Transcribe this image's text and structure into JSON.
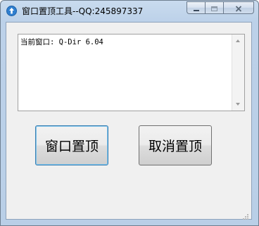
{
  "window": {
    "title": "窗口置顶工具--QQ:245897337",
    "app_icon": "up-arrow-circle-icon",
    "caption_icons": [
      "minimize-icon",
      "maximize-icon",
      "close-icon"
    ]
  },
  "content": {
    "current_window_text": "当前窗口: Q-Dir 6.04"
  },
  "buttons": {
    "pin_label": "窗口置顶",
    "unpin_label": "取消置顶"
  },
  "colors": {
    "accent": "#3c7fb1",
    "app_icon": "#2f7fd0"
  }
}
